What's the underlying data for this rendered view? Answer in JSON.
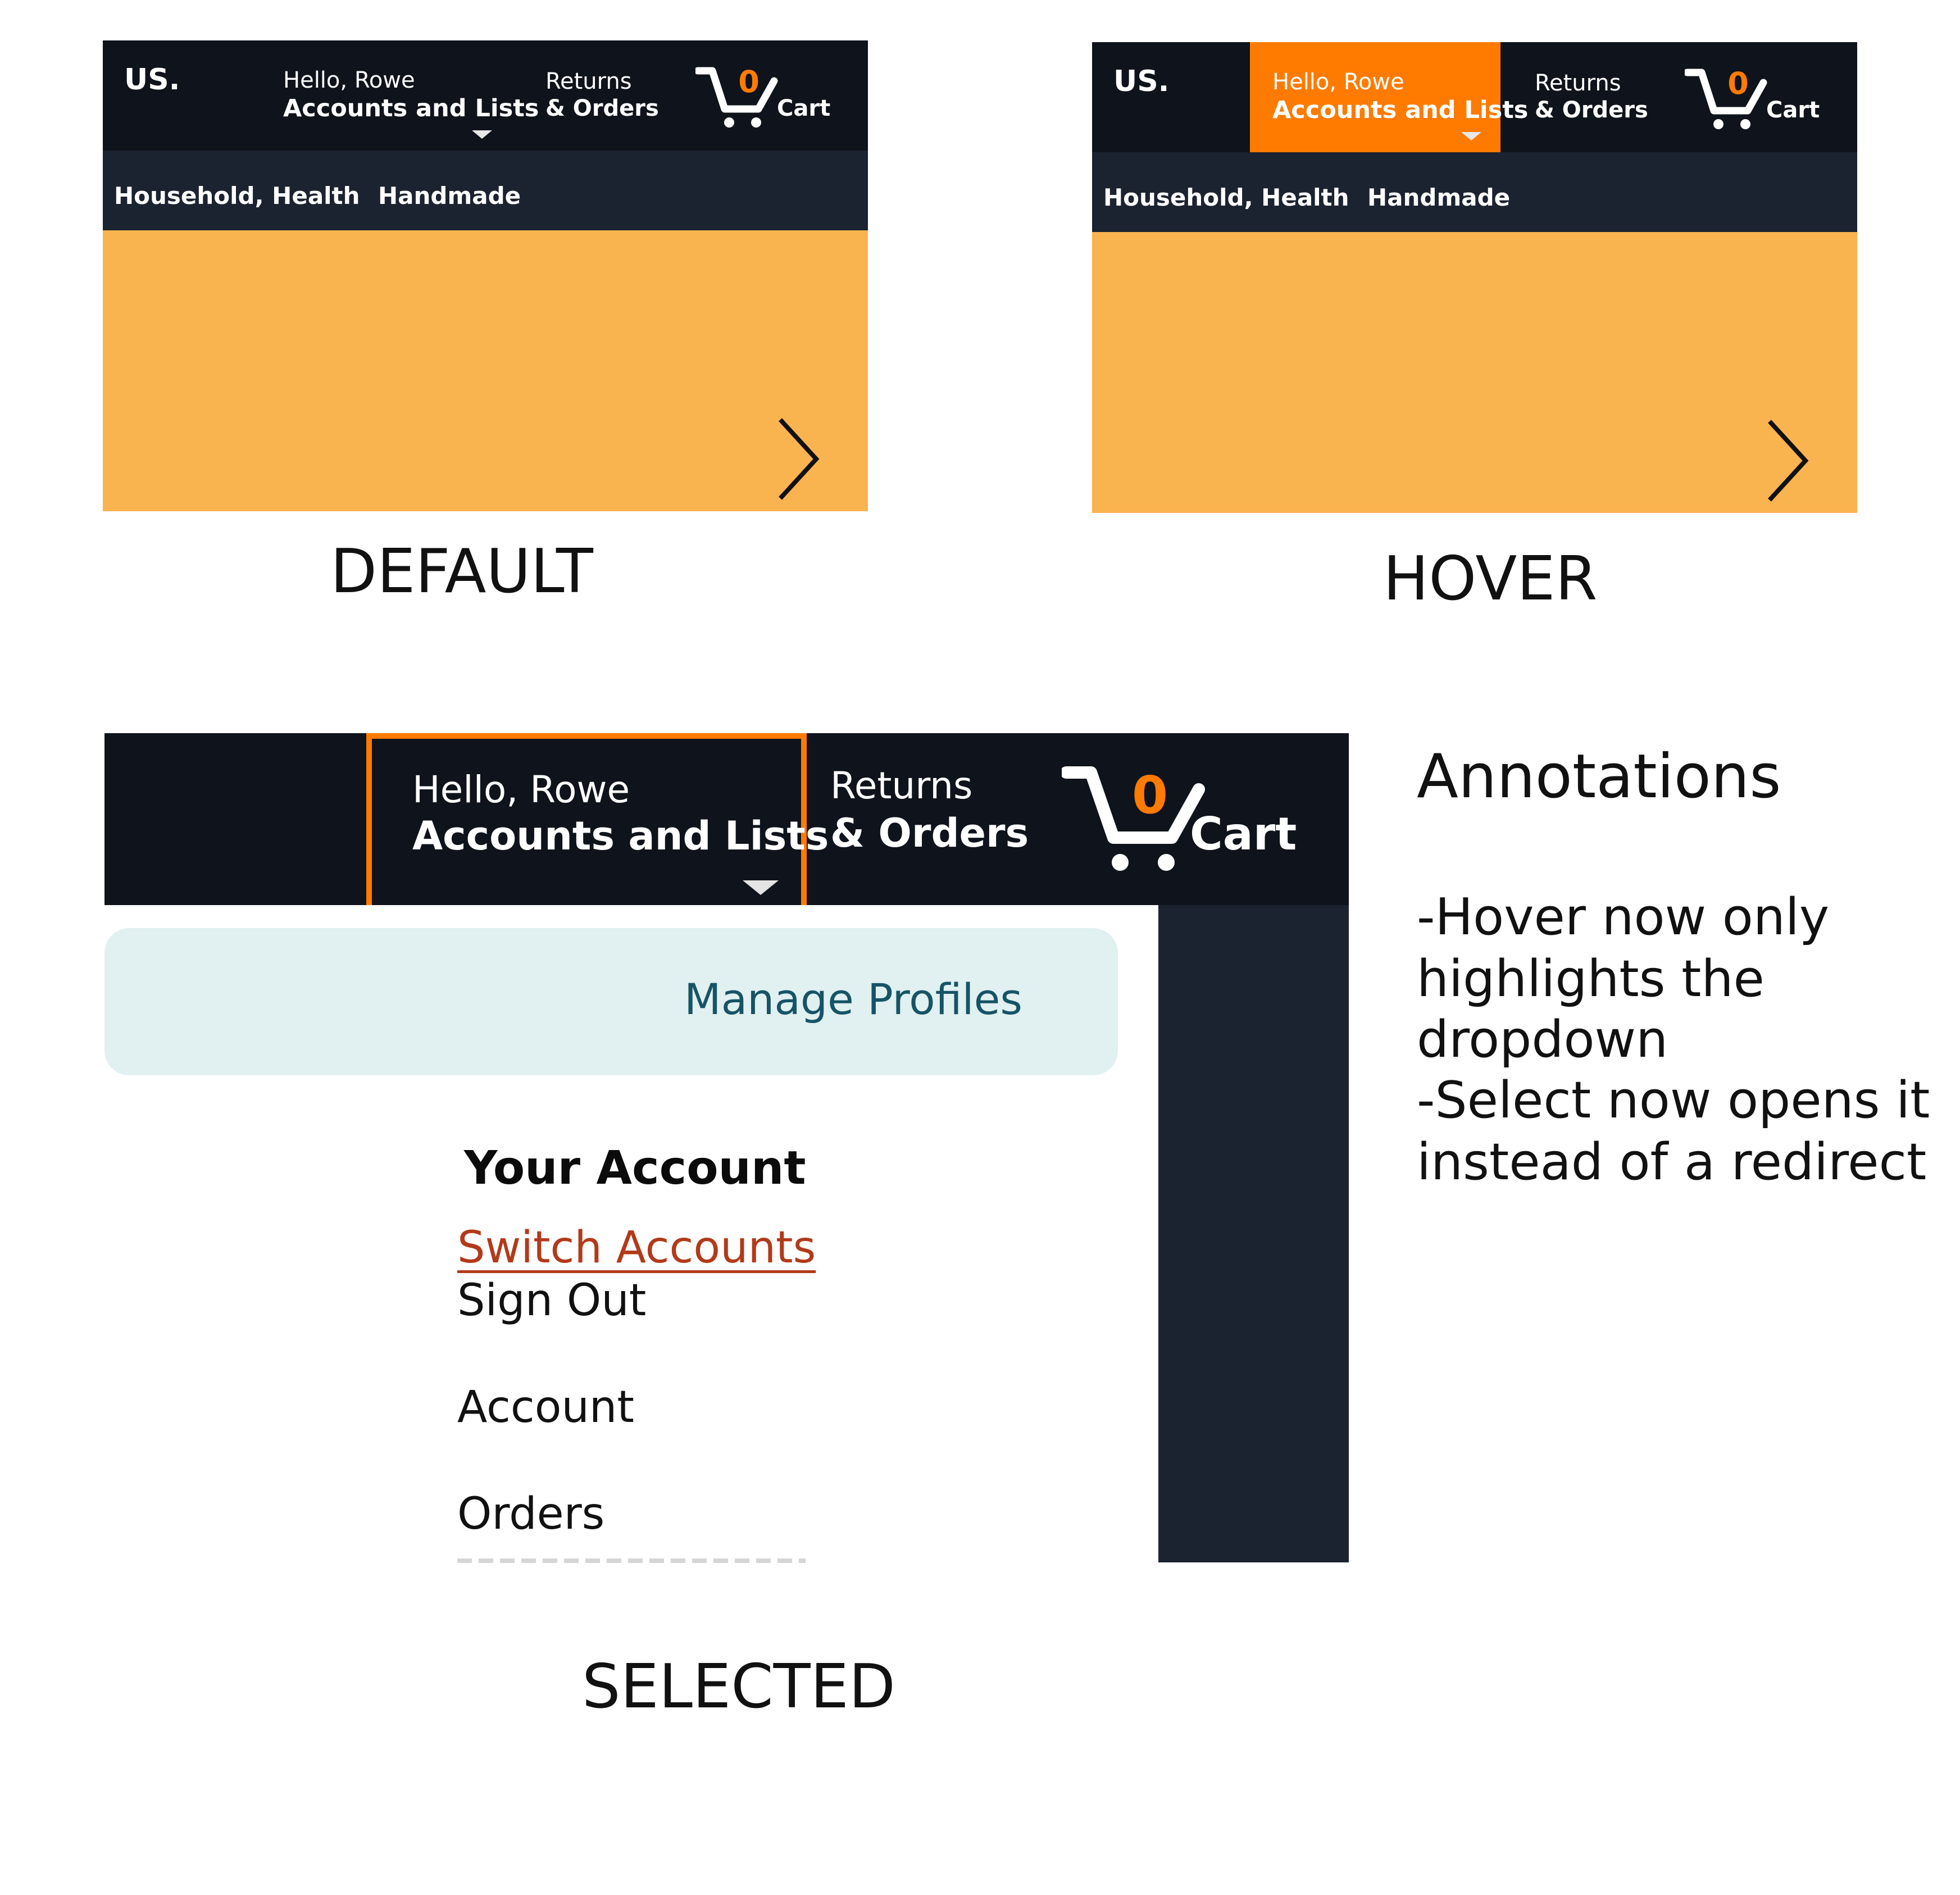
{
  "panels": {
    "default": {
      "state_label": "DEFAULT",
      "logo": "US.",
      "greeting": "Hello, Rowe",
      "account_label": "Accounts and Lists",
      "returns_line1": "Returns",
      "returns_line2": "& Orders",
      "cart_count": "0",
      "cart_label": "Cart",
      "subnav": [
        "Household, Health",
        "Handmade"
      ]
    },
    "hover": {
      "state_label": "HOVER",
      "logo": "US.",
      "greeting": "Hello, Rowe",
      "account_label": "Accounts and Lists",
      "returns_line1": "Returns",
      "returns_line2": "& Orders",
      "cart_count": "0",
      "cart_label": "Cart",
      "subnav": [
        "Household, Health",
        "Handmade"
      ]
    },
    "selected": {
      "state_label": "SELECTED",
      "greeting": "Hello, Rowe",
      "account_label": "Accounts and Lists",
      "returns_line1": "Returns",
      "returns_line2": "&  Orders",
      "cart_count": "0",
      "cart_label": "Cart",
      "dropdown": {
        "manage_profiles": "Manage Profiles",
        "section_title": "Your Account",
        "items": [
          "Switch Accounts",
          "Sign Out",
          "Account",
          "Orders"
        ]
      }
    }
  },
  "annotations": {
    "title": "Annotations",
    "lines": [
      "-Hover now only",
      "highlights the",
      "dropdown",
      "-Select now opens it",
      "instead of a redirect"
    ]
  },
  "colors": {
    "nav_dark": "#0f131b",
    "subnav_dark": "#1c2330",
    "banner": "#fab44f",
    "highlight_orange": "#ff7b00",
    "manage_bg": "#e1f0f0",
    "manage_text": "#165466",
    "link_red": "#b23a1a"
  },
  "icons": [
    "cart-icon",
    "chevron-right-icon",
    "caret-down-icon"
  ]
}
